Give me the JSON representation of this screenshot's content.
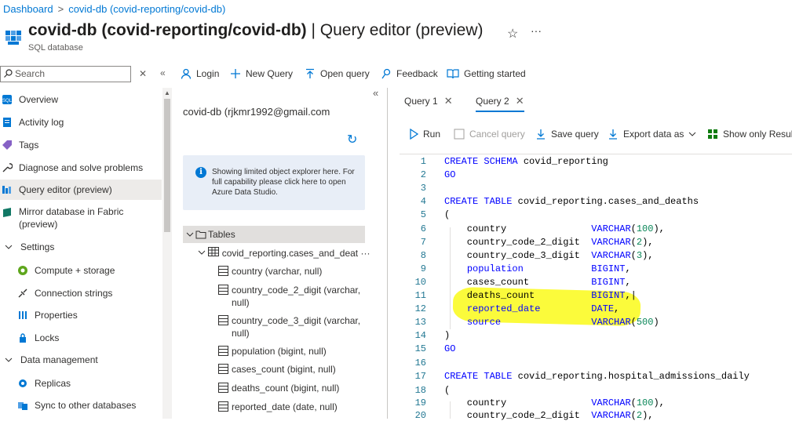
{
  "breadcrumb": {
    "items": [
      "Dashboard",
      "covid-db (covid-reporting/covid-db)"
    ]
  },
  "header": {
    "title": "covid-db (covid-reporting/covid-db)",
    "title_suffix": "| Query editor (preview)",
    "subtitle": "SQL database"
  },
  "search": {
    "placeholder": "Search"
  },
  "nav": {
    "items": [
      {
        "label": "Overview",
        "icon": "sql-icon"
      },
      {
        "label": "Activity log",
        "icon": "activity-log-icon"
      },
      {
        "label": "Tags",
        "icon": "tag-icon"
      },
      {
        "label": "Diagnose and solve problems",
        "icon": "wrench-icon"
      },
      {
        "label": "Query editor (preview)",
        "icon": "query-editor-icon",
        "selected": true
      },
      {
        "label": "Mirror database in Fabric",
        "label2": "(preview)",
        "icon": "fabric-icon"
      },
      {
        "label": "Settings",
        "icon": "chevron-down-icon",
        "group": true
      },
      {
        "label": "Compute + storage",
        "icon": "compute-icon"
      },
      {
        "label": "Connection strings",
        "icon": "connection-icon"
      },
      {
        "label": "Properties",
        "icon": "properties-icon"
      },
      {
        "label": "Locks",
        "icon": "lock-icon"
      },
      {
        "label": "Data management",
        "icon": "chevron-down-icon",
        "group": true
      },
      {
        "label": "Replicas",
        "icon": "replicas-icon"
      },
      {
        "label": "Sync to other databases",
        "icon": "sync-icon"
      }
    ]
  },
  "toolbar": {
    "login": "Login",
    "new_query": "New Query",
    "open_query": "Open query",
    "feedback": "Feedback",
    "getting_started": "Getting started"
  },
  "explorer": {
    "connection": "covid-db (rjkmr1992@gmail.com",
    "info": "Showing limited object explorer here. For full capability please click here to open Azure Data Studio.",
    "tables_label": "Tables",
    "table_name": "covid_reporting.cases_and_deat",
    "columns": [
      "country (varchar, null)",
      "country_code_2_digit (varchar,",
      "null)",
      "country_code_3_digit (varchar,",
      "null)",
      "population (bigint, null)",
      "cases_count (bigint, null)",
      "deaths_count (bigint, null)",
      "reported_date (date, null)"
    ]
  },
  "tabs": [
    {
      "label": "Query 1"
    },
    {
      "label": "Query 2",
      "active": true
    }
  ],
  "query_toolbar": {
    "run": "Run",
    "cancel": "Cancel query",
    "save": "Save query",
    "export": "Export data as",
    "show_only": "Show only Result"
  },
  "editor": {
    "lines": [
      {
        "n": "1",
        "t": [
          [
            "kw",
            "CREATE SCHEMA "
          ],
          [
            "",
            "covid_reporting"
          ]
        ]
      },
      {
        "n": "2",
        "t": [
          [
            "kw",
            "GO"
          ]
        ]
      },
      {
        "n": "3",
        "t": []
      },
      {
        "n": "4",
        "t": [
          [
            "kw",
            "CREATE TABLE "
          ],
          [
            "",
            "covid_reporting.cases_and_deaths"
          ]
        ]
      },
      {
        "n": "5",
        "t": [
          [
            "",
            "("
          ]
        ]
      },
      {
        "n": "6",
        "t": [
          [
            "",
            "    country               "
          ],
          [
            "kw",
            "VARCHAR"
          ],
          [
            "",
            "("
          ],
          [
            "num",
            "100"
          ],
          [
            "",
            "),"
          ]
        ]
      },
      {
        "n": "7",
        "t": [
          [
            "",
            "    country_code_2_digit  "
          ],
          [
            "kw",
            "VARCHAR"
          ],
          [
            "",
            "("
          ],
          [
            "num",
            "2"
          ],
          [
            "",
            "),"
          ]
        ]
      },
      {
        "n": "8",
        "t": [
          [
            "",
            "    country_code_3_digit  "
          ],
          [
            "kw",
            "VARCHAR"
          ],
          [
            "",
            "("
          ],
          [
            "num",
            "3"
          ],
          [
            "",
            "),"
          ]
        ]
      },
      {
        "n": "9",
        "t": [
          [
            "",
            "    "
          ],
          [
            "kw",
            "population            BIGINT"
          ],
          [
            "",
            ","
          ]
        ]
      },
      {
        "n": "10",
        "t": [
          [
            "",
            "    cases_count           "
          ],
          [
            "kw",
            "BIGINT"
          ],
          [
            "",
            ","
          ]
        ]
      },
      {
        "n": "11",
        "t": [
          [
            "",
            "    deaths_count          "
          ],
          [
            "kw",
            "BIGINT"
          ],
          [
            "",
            ",|"
          ]
        ]
      },
      {
        "n": "12",
        "t": [
          [
            "",
            "    "
          ],
          [
            "kw",
            "reported_date         DATE"
          ],
          [
            "",
            ","
          ]
        ]
      },
      {
        "n": "13",
        "t": [
          [
            "",
            "    "
          ],
          [
            "kw",
            "source                VARCHAR"
          ],
          [
            "",
            "("
          ],
          [
            "num",
            "500"
          ],
          [
            "",
            ")"
          ]
        ]
      },
      {
        "n": "14",
        "t": [
          [
            "",
            ")"
          ]
        ]
      },
      {
        "n": "15",
        "t": [
          [
            "kw",
            "GO"
          ]
        ]
      },
      {
        "n": "16",
        "t": []
      },
      {
        "n": "17",
        "t": [
          [
            "kw",
            "CREATE TABLE "
          ],
          [
            "",
            "covid_reporting.hospital_admissions_daily"
          ]
        ]
      },
      {
        "n": "18",
        "t": [
          [
            "",
            "("
          ]
        ]
      },
      {
        "n": "19",
        "t": [
          [
            "",
            "    country               "
          ],
          [
            "kw",
            "VARCHAR"
          ],
          [
            "",
            "("
          ],
          [
            "num",
            "100"
          ],
          [
            "",
            "),"
          ]
        ]
      },
      {
        "n": "20",
        "t": [
          [
            "",
            "    country_code_2_digit  "
          ],
          [
            "kw",
            "VARCHAR"
          ],
          [
            "",
            "("
          ],
          [
            "num",
            "2"
          ],
          [
            "",
            "),"
          ]
        ]
      }
    ]
  },
  "colors": {
    "accent": "#0078d4",
    "highlight": "#fbfb3b",
    "keyword": "#0000ff",
    "number": "#098658"
  }
}
